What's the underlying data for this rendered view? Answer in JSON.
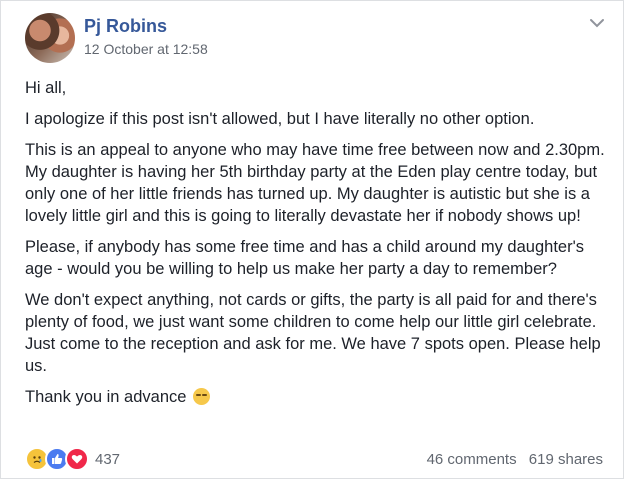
{
  "post": {
    "author": "Pj Robins",
    "timestamp": "12 October at 12:58",
    "paragraphs": [
      "Hi all,",
      "I apologize if this post isn't allowed, but I have literally no other option.",
      "This is an appeal to anyone who may have time free between now and 2.30pm. My daughter is having her 5th birthday party at the Eden play centre today, but only one of her little friends has turned up. My daughter is autistic but she is a lovely little girl and this is going to literally devastate her if nobody shows up!",
      "Please, if anybody has some free time and has a child around my daughter's age - would you be willing to help us make her party a day to remember?",
      "We don't expect anything, not cards or gifts, the party is all paid for and there's plenty of food, we just want some children to come help our little girl celebrate. Just come to the reception and ask for me. We have 7 spots open. Please help us.",
      "Thank you in advance"
    ],
    "closing_emoji": "pensive-face-emoji"
  },
  "footer": {
    "reaction_icons": [
      "sad-reaction-icon",
      "like-reaction-icon",
      "love-reaction-icon"
    ],
    "reaction_count": "437",
    "comments": "46 comments",
    "shares": "619 shares"
  },
  "colors": {
    "author_link": "#365899",
    "secondary_text": "#616770",
    "border": "#dddfe2"
  }
}
